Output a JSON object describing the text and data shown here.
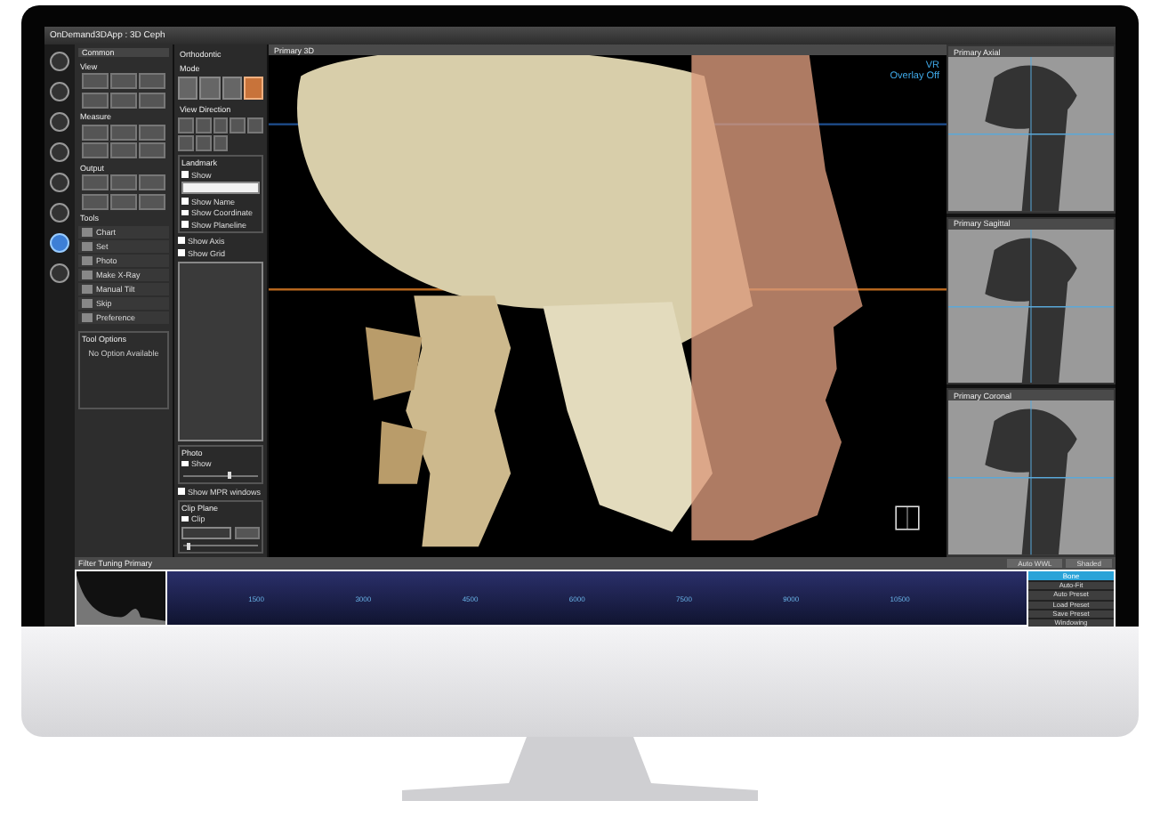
{
  "window": {
    "title": "OnDemand3DApp : 3D Ceph"
  },
  "sidebar": {
    "items": [
      {
        "selected": false
      },
      {
        "selected": false
      },
      {
        "selected": false
      },
      {
        "selected": false
      },
      {
        "selected": false
      },
      {
        "selected": false
      },
      {
        "selected": true
      },
      {
        "selected": false
      }
    ]
  },
  "toolbox": {
    "title": "Common",
    "sections": [
      {
        "title": "View",
        "kind": "icons"
      },
      {
        "title": "Measure",
        "kind": "icons"
      },
      {
        "title": "Output",
        "kind": "icons"
      },
      {
        "title": "Tools",
        "kind": "list",
        "items": [
          "Chart",
          "Set",
          "Photo",
          "Make X-Ray",
          "Manual Tilt",
          "Skip",
          "Preference"
        ]
      }
    ]
  },
  "tool_options": {
    "title": "Tool Options",
    "message": "No Option Available"
  },
  "orthodontic": {
    "title": "Orthodontic",
    "mode": {
      "title": "Mode",
      "buttons": [
        {
          "selected": false
        },
        {
          "selected": false
        },
        {
          "selected": false
        },
        {
          "selected": true
        }
      ]
    },
    "view_direction": {
      "title": "View Direction"
    },
    "landmark": {
      "title": "Landmark",
      "options": [
        {
          "label": "Show",
          "checked": false
        },
        {
          "label": "Show Name",
          "checked": false
        },
        {
          "label": "Show Coordinate",
          "checked": false
        },
        {
          "label": "Show Planeline",
          "checked": false
        }
      ]
    },
    "options": [
      {
        "label": "Show Axis",
        "checked": false
      },
      {
        "label": "Show Grid",
        "checked": false
      }
    ],
    "photo": {
      "title": "Photo",
      "show": {
        "label": "Show",
        "checked": false
      },
      "level": 0.6
    },
    "mpr": {
      "label": "Show MPR windows",
      "checked": false
    },
    "clip_plane": {
      "title": "Clip Plane",
      "clip": {
        "label": "Clip",
        "checked": false
      },
      "level": 0.05
    }
  },
  "viewport": {
    "title": "Primary 3D",
    "overlay": [
      "VR",
      "Overlay Off"
    ]
  },
  "mpr_views": [
    {
      "title": "Primary Axial"
    },
    {
      "title": "Primary Sagittal"
    },
    {
      "title": "Primary Coronal"
    }
  ],
  "filter": {
    "title": "Filter Tuning Primary",
    "buttons": [
      "Auto WWL",
      "Shaded"
    ],
    "ticks": [
      "1500",
      "3000",
      "4500",
      "6000",
      "7500",
      "9000",
      "10500"
    ]
  },
  "presets": {
    "items": [
      {
        "label": "Bone",
        "selected": true
      }
    ],
    "buttons": [
      "Auto-Fit",
      "Auto Preset",
      "Load Preset",
      "Save Preset",
      "Windowing"
    ]
  }
}
